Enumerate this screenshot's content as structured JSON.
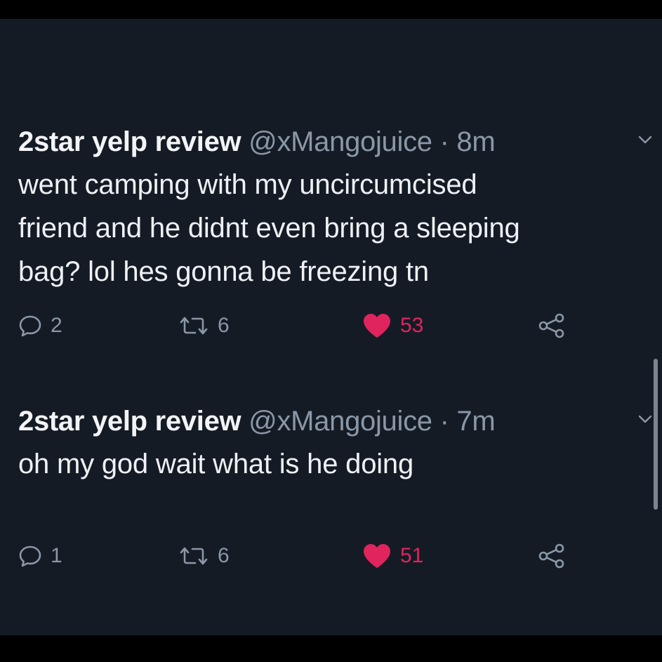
{
  "tweets": [
    {
      "name": "2star yelp review",
      "handle": "@xMangojuice",
      "separator": "·",
      "time": "8m",
      "text_lines": [
        "went camping with my uncircumcised",
        "friend and he didnt even bring a sleeping",
        "bag? lol hes gonna be freezing tn"
      ],
      "replies": "2",
      "retweets": "6",
      "likes": "53",
      "liked": true
    },
    {
      "name": "2star yelp review",
      "handle": "@xMangojuice",
      "separator": "·",
      "time": "7m",
      "text_lines": [
        "oh my god wait what is he doing"
      ],
      "replies": "1",
      "retweets": "6",
      "likes": "51",
      "liked": true
    }
  ],
  "icons": {
    "reply": "comment-bubble-icon",
    "retweet": "retweet-icon",
    "like": "heart-icon",
    "share": "share-icon",
    "menu": "chevron-down-icon"
  },
  "colors": {
    "background": "#151b25",
    "text": "#eef1f5",
    "muted": "#8a97a6",
    "like": "#e0245e"
  }
}
